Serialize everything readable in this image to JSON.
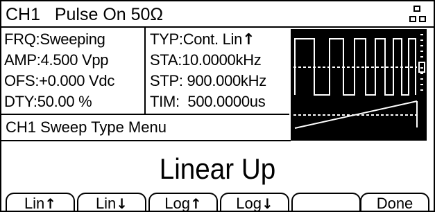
{
  "status": {
    "text": "CH1   Pulse On 50Ω",
    "icon": "channel-indicator-icon"
  },
  "params_left": [
    "FRQ:Sweeping",
    "AMP:4.500 Vpp",
    "OFS:+0.000 Vdc",
    "DTY:50.00 %"
  ],
  "params_right": [
    "TYP:Cont. Lin",
    "STA:10.0000kHz",
    "STP: 900.000kHz",
    "TIM:  500.0000us"
  ],
  "waveform": {
    "icon": "sweep-waveform-preview",
    "colors": {
      "background": "#000000",
      "trace": "#ffffff"
    }
  },
  "menu": {
    "title": "CH1 Sweep Type Menu",
    "selected_value": "Linear Up"
  },
  "softkeys": [
    {
      "label": "Lin",
      "arrow": "↑"
    },
    {
      "label": "Lin",
      "arrow": "↓"
    },
    {
      "label": "Log",
      "arrow": "↑"
    },
    {
      "label": "Log",
      "arrow": "↓"
    },
    {
      "label": "",
      "arrow": ""
    },
    {
      "label": "Done",
      "arrow": ""
    }
  ]
}
